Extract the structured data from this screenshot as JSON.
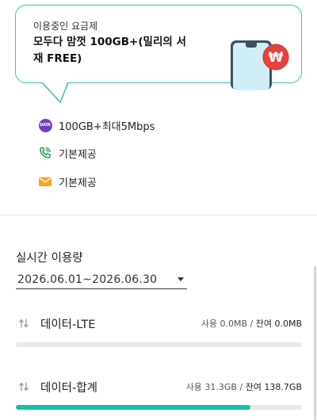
{
  "plan": {
    "subtitle": "이용중인 요금제",
    "name": "모두다 맘껏 100GB+(밀리의 서재 FREE)",
    "currency_symbol": "₩"
  },
  "features": [
    {
      "icon": "data-badge-icon",
      "badge": "DATA",
      "label": "100GB+최대5Mbps"
    },
    {
      "icon": "phone-call-icon",
      "label": "기본제공"
    },
    {
      "icon": "envelope-icon",
      "label": "기본제공"
    }
  ],
  "usage": {
    "title": "실시간 이용량",
    "period": "2026.06.01~2026.06.30",
    "rows": [
      {
        "name": "데이터-LTE",
        "used_label": "사용 0.0MB",
        "separator": " / ",
        "remain_label": "잔여 0.0MB",
        "progress": 0.0
      },
      {
        "name": "데이터-합계",
        "used_label": "사용 31.3GB",
        "separator": " / ",
        "remain_label": "잔여 138.7GB",
        "progress": 0.82
      }
    ]
  },
  "colors": {
    "accent": "#14bfa6",
    "card_border": "#2ec4b0",
    "data_badge": "#6b3fc0",
    "coin": "#e8423f"
  }
}
